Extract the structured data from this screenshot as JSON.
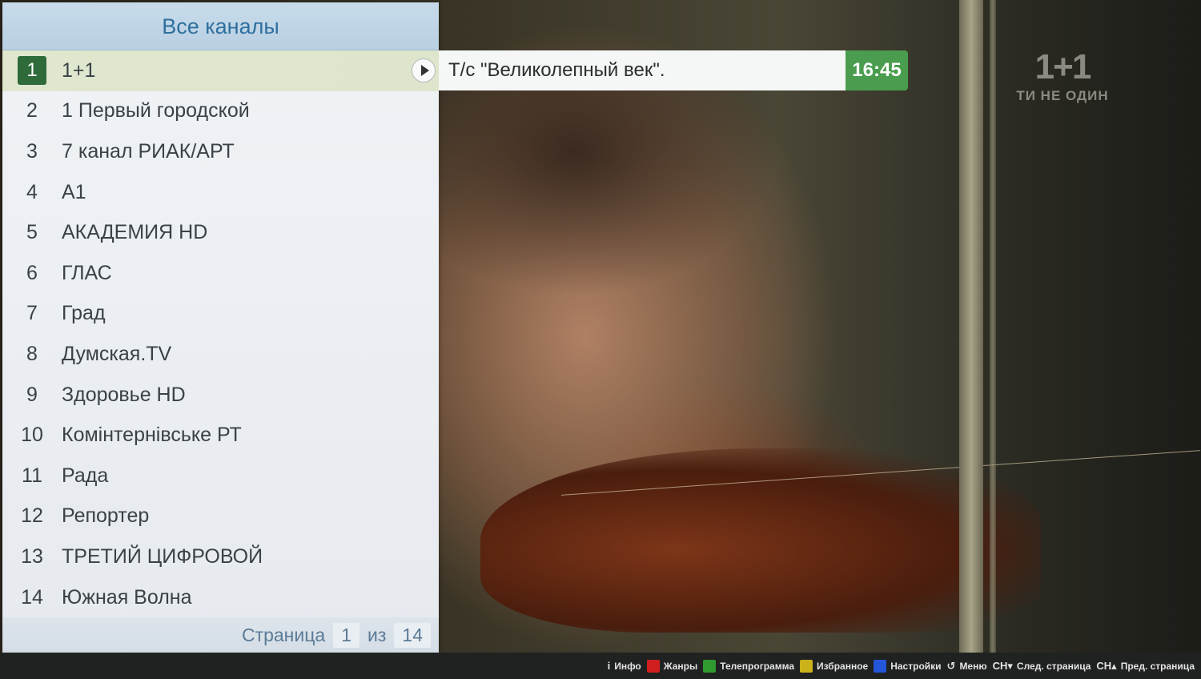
{
  "panel": {
    "title": "Все каналы",
    "channels": [
      {
        "num": "1",
        "name": "1+1"
      },
      {
        "num": "2",
        "name": "1 Первый городской"
      },
      {
        "num": "3",
        "name": "7 канал РИАК/АРТ"
      },
      {
        "num": "4",
        "name": "А1"
      },
      {
        "num": "5",
        "name": "АКАДЕМИЯ HD"
      },
      {
        "num": "6",
        "name": "ГЛАС"
      },
      {
        "num": "7",
        "name": "Град"
      },
      {
        "num": "8",
        "name": "Думская.TV"
      },
      {
        "num": "9",
        "name": "Здоровье HD"
      },
      {
        "num": "10",
        "name": "Комінтернівське РТ"
      },
      {
        "num": "11",
        "name": "Рада"
      },
      {
        "num": "12",
        "name": "Репортер"
      },
      {
        "num": "13",
        "name": "ТРЕТИЙ ЦИФРОВОЙ"
      },
      {
        "num": "14",
        "name": "Южная Волна"
      }
    ],
    "selected_index": 0,
    "pager": {
      "label": "Страница",
      "current": "1",
      "of_label": "из",
      "total": "14"
    }
  },
  "program": {
    "title": "Т/с \"Великолепный век\".",
    "time": "16:45"
  },
  "logo": {
    "mark": "1+1",
    "slogan": "ТИ НЕ ОДИН"
  },
  "hints": [
    {
      "icon": "info-icon",
      "label": "Инфо"
    },
    {
      "icon": "red-key-icon",
      "color": "#d11f1f",
      "label": "Жанры"
    },
    {
      "icon": "green-key-icon",
      "color": "#2f9a2f",
      "label": "Телепрограмма"
    },
    {
      "icon": "yellow-key-icon",
      "color": "#c9b21a",
      "label": "Избранное"
    },
    {
      "icon": "blue-key-icon",
      "color": "#2356d8",
      "label": "Настройки"
    },
    {
      "icon": "return-icon",
      "label": "Меню"
    },
    {
      "icon": "channel-down-icon",
      "label": "След. страница"
    },
    {
      "icon": "channel-up-icon",
      "label": "Пред. страница"
    }
  ],
  "colors": {
    "accent_green": "#4a9d4e",
    "header_blue": "#2f6f9e",
    "selected_badge": "#2f6a3b"
  }
}
